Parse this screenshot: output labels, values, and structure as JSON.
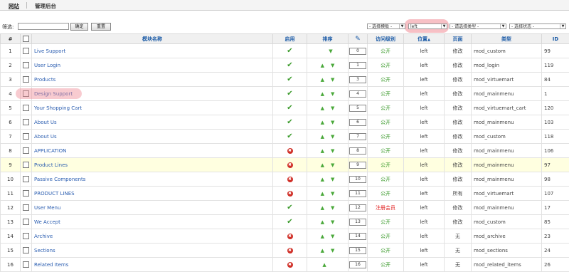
{
  "nav": {
    "tab_site": "网站",
    "tab_admin": "管理后台"
  },
  "filter": {
    "label": "筛选:",
    "search_value": "",
    "go_label": "确定",
    "reset_label": "重置",
    "template_select": "- 选择模板 -",
    "position_select": "left",
    "type_select": "- 请选择类型 -",
    "state_select": "- 选择状态 -"
  },
  "columns": {
    "num": "#",
    "name": "模块名称",
    "enabled": "启用",
    "order": "排序",
    "access": "访问级别",
    "position": "位置",
    "pages": "页面",
    "type": "类型",
    "id": "ID"
  },
  "rows": [
    {
      "num": "1",
      "name": "Live Support",
      "enabled": true,
      "order": "0",
      "access": "公开",
      "access_color": "green",
      "position": "left",
      "pages": "修改",
      "type": "mod_custom",
      "id": "99"
    },
    {
      "num": "2",
      "name": "User Login",
      "enabled": true,
      "order": "1",
      "access": "公开",
      "access_color": "green",
      "position": "left",
      "pages": "修改",
      "type": "mod_login",
      "id": "119"
    },
    {
      "num": "3",
      "name": "Products",
      "enabled": true,
      "order": "3",
      "access": "公开",
      "access_color": "green",
      "position": "left",
      "pages": "修改",
      "type": "mod_virtuemart",
      "id": "84"
    },
    {
      "num": "4",
      "name": "Design Support",
      "enabled": true,
      "order": "4",
      "access": "公开",
      "access_color": "green",
      "position": "left",
      "pages": "修改",
      "type": "mod_mainmenu",
      "id": "1"
    },
    {
      "num": "5",
      "name": "Your Shopping Cart",
      "enabled": true,
      "order": "5",
      "access": "公开",
      "access_color": "green",
      "position": "left",
      "pages": "修改",
      "type": "mod_virtuemart_cart",
      "id": "120"
    },
    {
      "num": "6",
      "name": "About Us",
      "enabled": true,
      "order": "6",
      "access": "公开",
      "access_color": "green",
      "position": "left",
      "pages": "修改",
      "type": "mod_mainmenu",
      "id": "103"
    },
    {
      "num": "7",
      "name": "About Us",
      "enabled": true,
      "order": "7",
      "access": "公开",
      "access_color": "green",
      "position": "left",
      "pages": "修改",
      "type": "mod_custom",
      "id": "118"
    },
    {
      "num": "8",
      "name": "APPLICATION",
      "enabled": false,
      "order": "8",
      "access": "公开",
      "access_color": "green",
      "position": "left",
      "pages": "修改",
      "type": "mod_mainmenu",
      "id": "106"
    },
    {
      "num": "9",
      "name": "Product Lines",
      "enabled": false,
      "order": "9",
      "access": "公开",
      "access_color": "green",
      "position": "left",
      "pages": "修改",
      "type": "mod_mainmenu",
      "id": "97"
    },
    {
      "num": "10",
      "name": "Passive Components",
      "enabled": false,
      "order": "10",
      "access": "公开",
      "access_color": "green",
      "position": "left",
      "pages": "修改",
      "type": "mod_mainmenu",
      "id": "98"
    },
    {
      "num": "11",
      "name": "PRODUCT LINES",
      "enabled": false,
      "order": "11",
      "access": "公开",
      "access_color": "green",
      "position": "left",
      "pages": "所有",
      "type": "mod_virtuemart",
      "id": "107"
    },
    {
      "num": "12",
      "name": "User Menu",
      "enabled": true,
      "order": "12",
      "access": "注册会员",
      "access_color": "red",
      "position": "left",
      "pages": "修改",
      "type": "mod_mainmenu",
      "id": "17"
    },
    {
      "num": "13",
      "name": "We Accept",
      "enabled": true,
      "order": "13",
      "access": "公开",
      "access_color": "green",
      "position": "left",
      "pages": "修改",
      "type": "mod_custom",
      "id": "85"
    },
    {
      "num": "14",
      "name": "Archive",
      "enabled": false,
      "order": "14",
      "access": "公开",
      "access_color": "green",
      "position": "left",
      "pages": "无",
      "type": "mod_archive",
      "id": "23"
    },
    {
      "num": "15",
      "name": "Sections",
      "enabled": false,
      "order": "15",
      "access": "公开",
      "access_color": "green",
      "position": "left",
      "pages": "无",
      "type": "mod_sections",
      "id": "24"
    },
    {
      "num": "16",
      "name": "Related Items",
      "enabled": false,
      "order": "16",
      "access": "公开",
      "access_color": "green",
      "position": "left",
      "pages": "无",
      "type": "mod_related_items",
      "id": "26"
    }
  ]
}
